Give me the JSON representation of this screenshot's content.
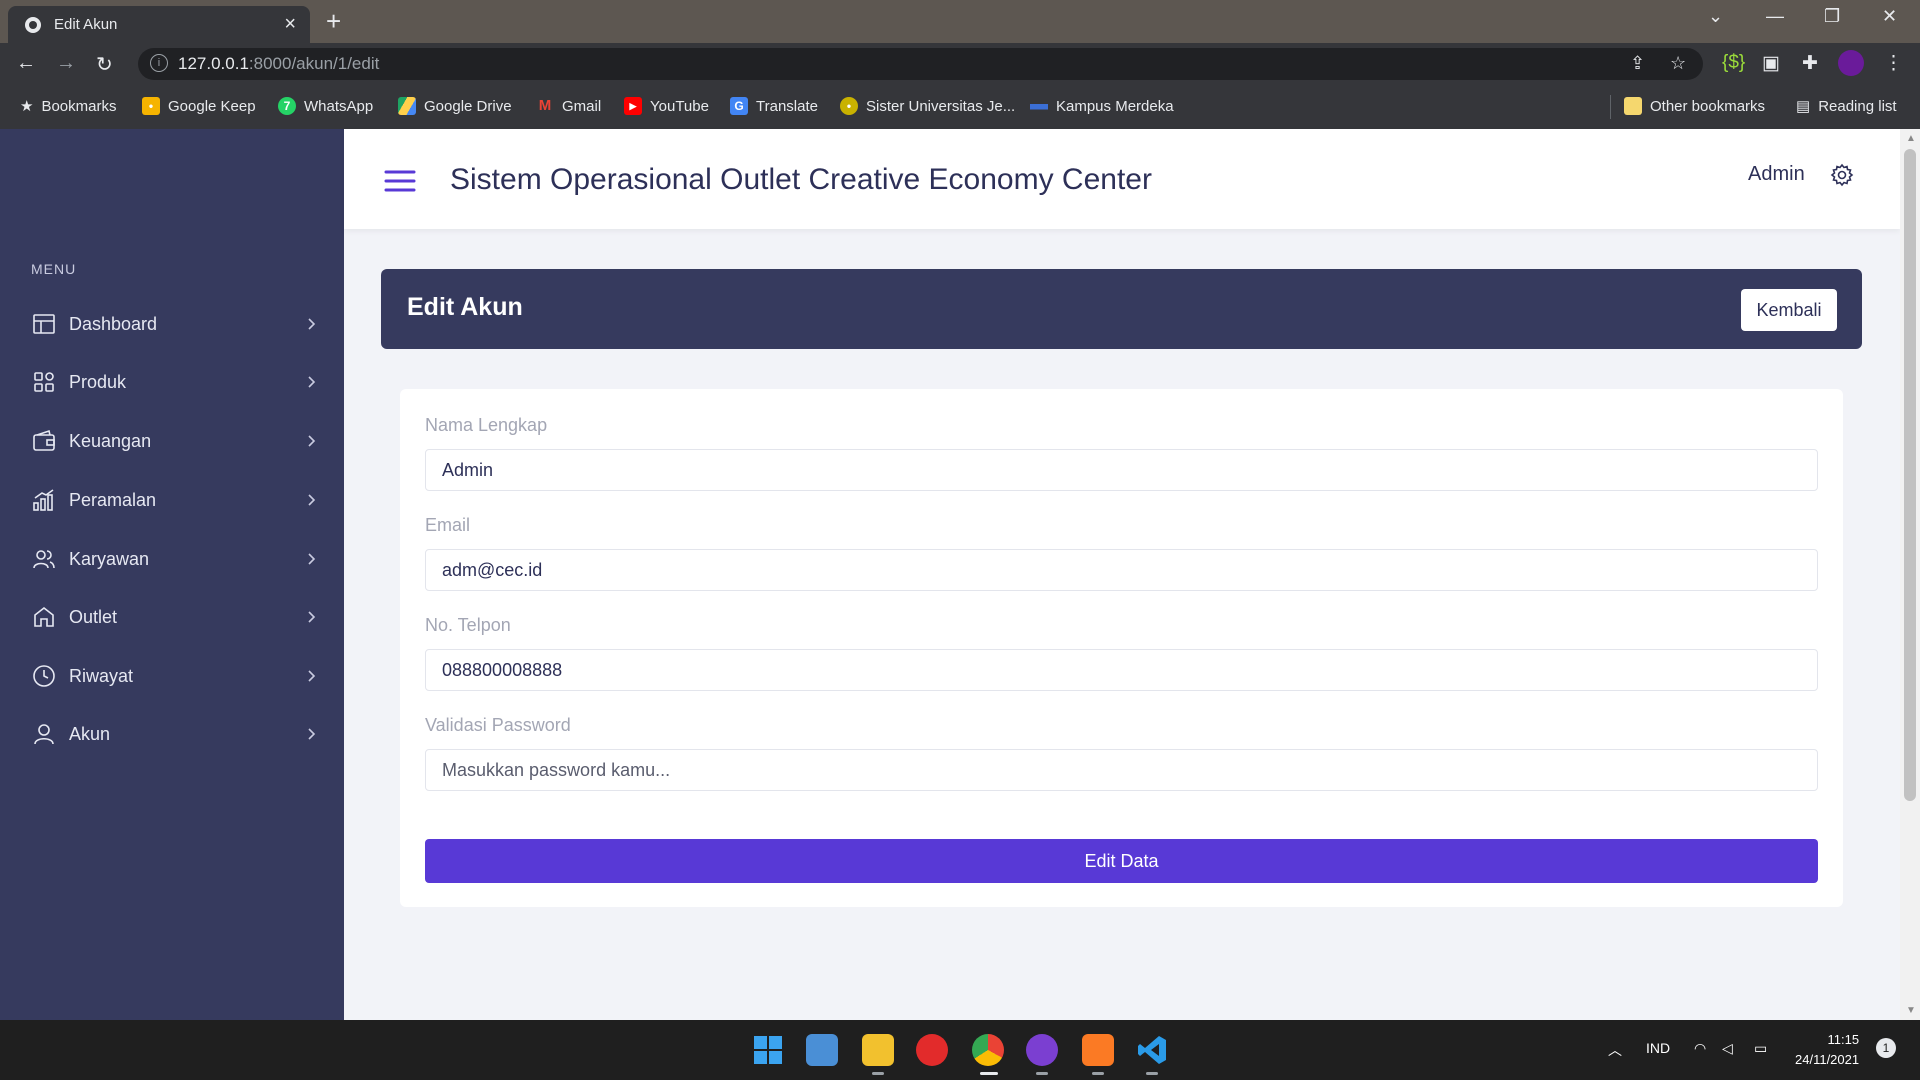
{
  "browser": {
    "tab_title": "Edit Akun",
    "url_host": "127.0.0.1",
    "url_rest": ":8000/akun/1/edit",
    "bookmarks": [
      {
        "label": "Bookmarks",
        "icon": "star-icon"
      },
      {
        "label": "Google Keep",
        "icon": "google-keep-icon"
      },
      {
        "label": "WhatsApp",
        "icon": "whatsapp-icon"
      },
      {
        "label": "Google Drive",
        "icon": "google-drive-icon"
      },
      {
        "label": "Gmail",
        "icon": "gmail-icon"
      },
      {
        "label": "YouTube",
        "icon": "youtube-icon"
      },
      {
        "label": "Translate",
        "icon": "translate-icon"
      },
      {
        "label": "Sister Universitas Je...",
        "icon": "university-icon"
      },
      {
        "label": "Kampus Merdeka",
        "icon": "kampus-merdeka-icon"
      }
    ],
    "other_bookmarks": "Other bookmarks",
    "reading_list": "Reading list"
  },
  "sidebar": {
    "menu_label": "MENU",
    "items": [
      {
        "label": "Dashboard"
      },
      {
        "label": "Produk"
      },
      {
        "label": "Keuangan"
      },
      {
        "label": "Peramalan"
      },
      {
        "label": "Karyawan"
      },
      {
        "label": "Outlet"
      },
      {
        "label": "Riwayat"
      },
      {
        "label": "Akun"
      }
    ]
  },
  "header": {
    "title": "Sistem Operasional Outlet Creative Economy Center",
    "user": "Admin"
  },
  "page": {
    "title": "Edit Akun",
    "back_button": "Kembali"
  },
  "form": {
    "name_label": "Nama Lengkap",
    "name_value": "Admin",
    "email_label": "Email",
    "email_value": "adm@cec.id",
    "phone_label": "No. Telpon",
    "phone_value": "088800008888",
    "password_label": "Validasi Password",
    "password_placeholder": "Masukkan password kamu...",
    "submit_label": "Edit Data"
  },
  "taskbar": {
    "language": "IND",
    "time": "11:15",
    "date": "24/11/2021",
    "notification_count": "1"
  },
  "colors": {
    "sidebar_bg": "#363a5e",
    "accent": "#5839d6",
    "title_text": "#2d3058"
  }
}
